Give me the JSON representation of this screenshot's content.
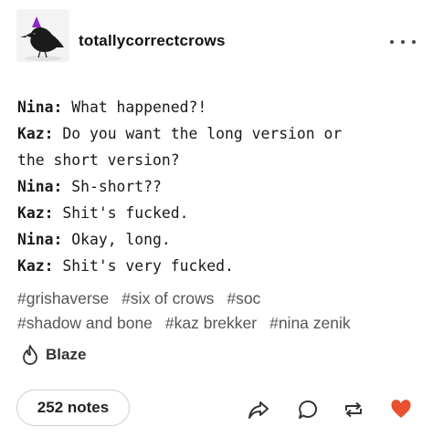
{
  "post": {
    "blog_name": "totallycorrectcrows",
    "avatar_icon": "crow-with-party-hat-icon",
    "more_icon": "more-dots-icon",
    "chat": [
      {
        "speaker": "Nina:",
        "text": "What happened?!"
      },
      {
        "speaker": "Kaz:",
        "text": "Do you want the long version or"
      },
      {
        "speaker": "",
        "text": "the short version?"
      },
      {
        "speaker": "Nina:",
        "text": "Sh-short??"
      },
      {
        "speaker": "Kaz:",
        "text": "Shit's fucked."
      },
      {
        "speaker": "Nina:",
        "text": "Okay, long."
      },
      {
        "speaker": "Kaz:",
        "text": "Shit's very fucked."
      }
    ],
    "tags_row1": [
      "#grishaverse",
      "#six of crows",
      "#soc"
    ],
    "tags_row2": [
      "#shadow and bone",
      "#kaz brekker",
      "#nina zenik"
    ]
  },
  "footer": {
    "blaze_label": "Blaze",
    "blaze_icon": "flame-icon",
    "notes_label": "252 notes",
    "share_icon": "share-arrow-icon",
    "reply_icon": "speech-bubble-icon",
    "reblog_icon": "reblog-icon",
    "like_icon": "heart-icon",
    "like_color": "#e8502f",
    "icon_color": "#333333"
  }
}
